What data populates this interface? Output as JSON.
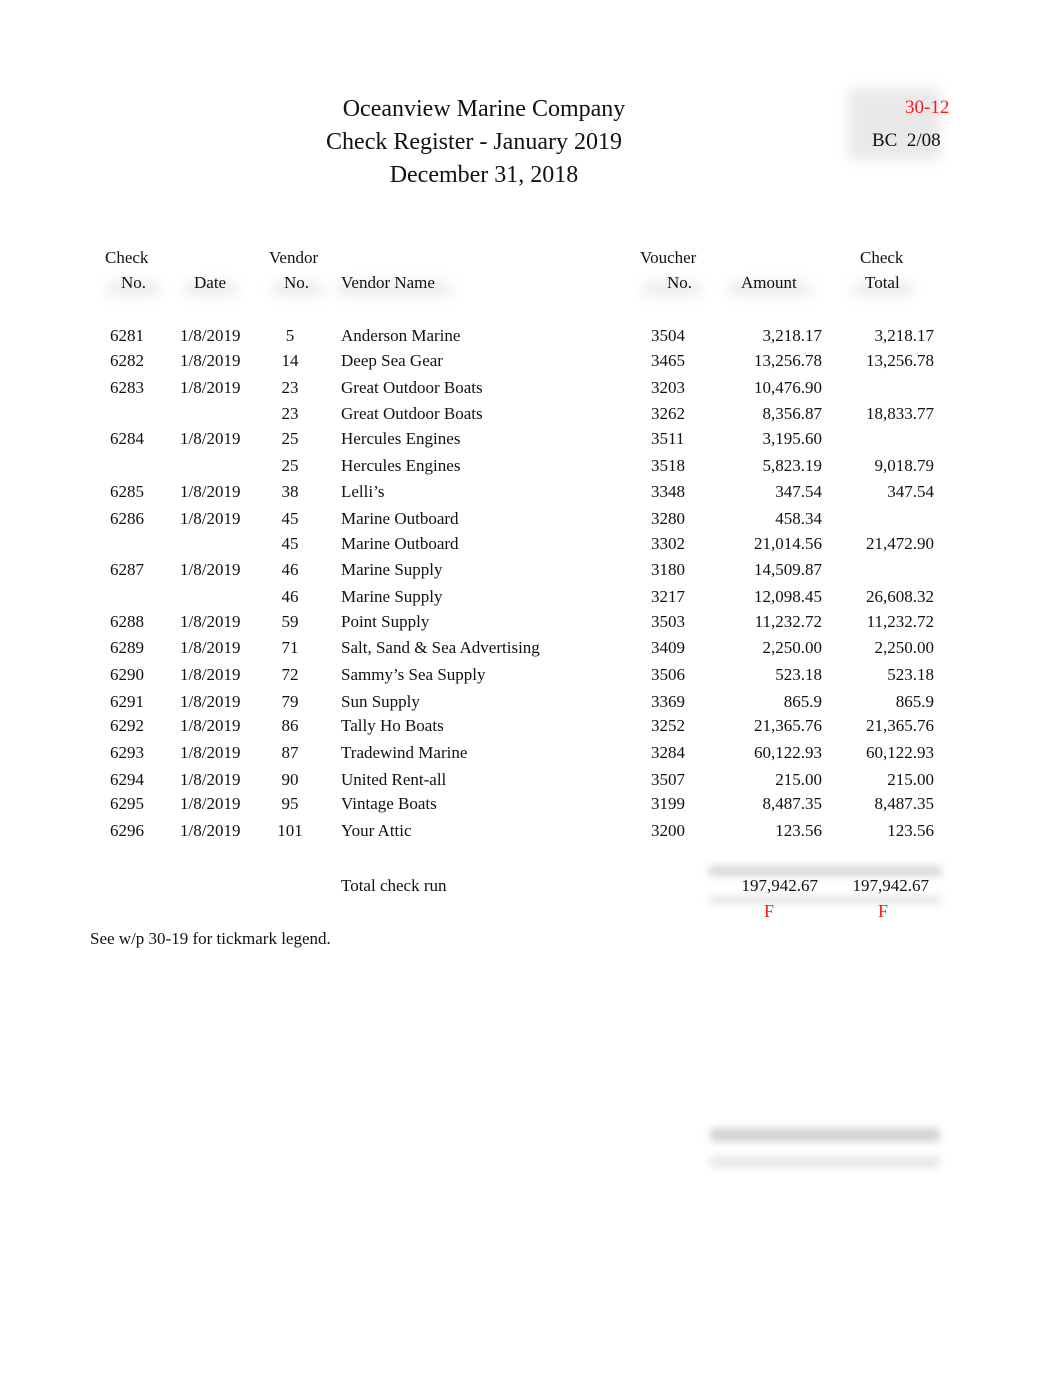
{
  "header": {
    "company": "Oceanview Marine Company",
    "report_title": "Check Register - January 2019",
    "date": "December 31, 2018",
    "wp_reference": "30-12",
    "preparer_signoff": "BC  2/08"
  },
  "columns": {
    "check_no": [
      "Check",
      "No."
    ],
    "date": [
      "",
      "Date"
    ],
    "vendor_no": [
      "Vendor",
      "No."
    ],
    "vendor_name": [
      "",
      "Vendor Name"
    ],
    "voucher_no": [
      "Voucher",
      "No."
    ],
    "amount": [
      "",
      "Amount"
    ],
    "check_total": [
      "Check",
      "Total"
    ]
  },
  "rows": [
    {
      "check_no": "6281",
      "date": "1/8/2019",
      "vendor_no": "5",
      "vendor_name": "Anderson Marine",
      "voucher_no": "3504",
      "amount": "3,218.17",
      "check_total": "3,218.17"
    },
    {
      "check_no": "6282",
      "date": "1/8/2019",
      "vendor_no": "14",
      "vendor_name": "Deep Sea Gear",
      "voucher_no": "3465",
      "amount": "13,256.78",
      "check_total": "13,256.78"
    },
    {
      "check_no": "6283",
      "date": "1/8/2019",
      "vendor_no": "23",
      "vendor_name": "Great Outdoor Boats",
      "voucher_no": "3203",
      "amount": "10,476.90",
      "check_total": ""
    },
    {
      "check_no": "",
      "date": "",
      "vendor_no": "23",
      "vendor_name": "Great Outdoor Boats",
      "voucher_no": "3262",
      "amount": "8,356.87",
      "check_total": "18,833.77"
    },
    {
      "check_no": "6284",
      "date": "1/8/2019",
      "vendor_no": "25",
      "vendor_name": "Hercules Engines",
      "voucher_no": "3511",
      "amount": "3,195.60",
      "check_total": ""
    },
    {
      "check_no": "",
      "date": "",
      "vendor_no": "25",
      "vendor_name": "Hercules Engines",
      "voucher_no": "3518",
      "amount": "5,823.19",
      "check_total": "9,018.79"
    },
    {
      "check_no": "6285",
      "date": "1/8/2019",
      "vendor_no": "38",
      "vendor_name": "Lelli’s",
      "voucher_no": "3348",
      "amount": "347.54",
      "check_total": "347.54"
    },
    {
      "check_no": "6286",
      "date": "1/8/2019",
      "vendor_no": "45",
      "vendor_name": "Marine Outboard",
      "voucher_no": "3280",
      "amount": "458.34",
      "check_total": ""
    },
    {
      "check_no": "",
      "date": "",
      "vendor_no": "45",
      "vendor_name": "Marine Outboard",
      "voucher_no": "3302",
      "amount": "21,014.56",
      "check_total": "21,472.90"
    },
    {
      "check_no": "6287",
      "date": "1/8/2019",
      "vendor_no": "46",
      "vendor_name": "Marine Supply",
      "voucher_no": "3180",
      "amount": "14,509.87",
      "check_total": ""
    },
    {
      "check_no": "",
      "date": "",
      "vendor_no": "46",
      "vendor_name": "Marine Supply",
      "voucher_no": "3217",
      "amount": "12,098.45",
      "check_total": "26,608.32"
    },
    {
      "check_no": "6288",
      "date": "1/8/2019",
      "vendor_no": "59",
      "vendor_name": "Point Supply",
      "voucher_no": "3503",
      "amount": "11,232.72",
      "check_total": "11,232.72"
    },
    {
      "check_no": "6289",
      "date": "1/8/2019",
      "vendor_no": "71",
      "vendor_name": "Salt, Sand & Sea Advertising",
      "voucher_no": "3409",
      "amount": "2,250.00",
      "check_total": "2,250.00"
    },
    {
      "check_no": "6290",
      "date": "1/8/2019",
      "vendor_no": "72",
      "vendor_name": "Sammy’s Sea Supply",
      "voucher_no": "3506",
      "amount": "523.18",
      "check_total": "523.18"
    },
    {
      "check_no": "6291",
      "date": "1/8/2019",
      "vendor_no": "79",
      "vendor_name": "Sun Supply",
      "voucher_no": "3369",
      "amount": "865.9",
      "check_total": "865.9"
    },
    {
      "check_no": "6292",
      "date": "1/8/2019",
      "vendor_no": "86",
      "vendor_name": "Tally Ho Boats",
      "voucher_no": "3252",
      "amount": "21,365.76",
      "check_total": "21,365.76"
    },
    {
      "check_no": "6293",
      "date": "1/8/2019",
      "vendor_no": "87",
      "vendor_name": "Tradewind Marine",
      "voucher_no": "3284",
      "amount": "60,122.93",
      "check_total": "60,122.93"
    },
    {
      "check_no": "6294",
      "date": "1/8/2019",
      "vendor_no": "90",
      "vendor_name": "United Rent-all",
      "voucher_no": "3507",
      "amount": "215.00",
      "check_total": "215.00"
    },
    {
      "check_no": "6295",
      "date": "1/8/2019",
      "vendor_no": "95",
      "vendor_name": "Vintage Boats",
      "voucher_no": "3199",
      "amount": "8,487.35",
      "check_total": "8,487.35"
    },
    {
      "check_no": "6296",
      "date": "1/8/2019",
      "vendor_no": "101",
      "vendor_name": "Your Attic",
      "voucher_no": "3200",
      "amount": "123.56",
      "check_total": "123.56"
    }
  ],
  "totals": {
    "label": "Total check run",
    "amount": "197,942.67",
    "check_total": "197,942.67",
    "amount_tickmark": "F",
    "check_total_tickmark": "F"
  },
  "footer_note": "See w/p 30-19 for tickmark legend.",
  "colors": {
    "tickmark": "#ff1a1a",
    "text": "#111111"
  }
}
